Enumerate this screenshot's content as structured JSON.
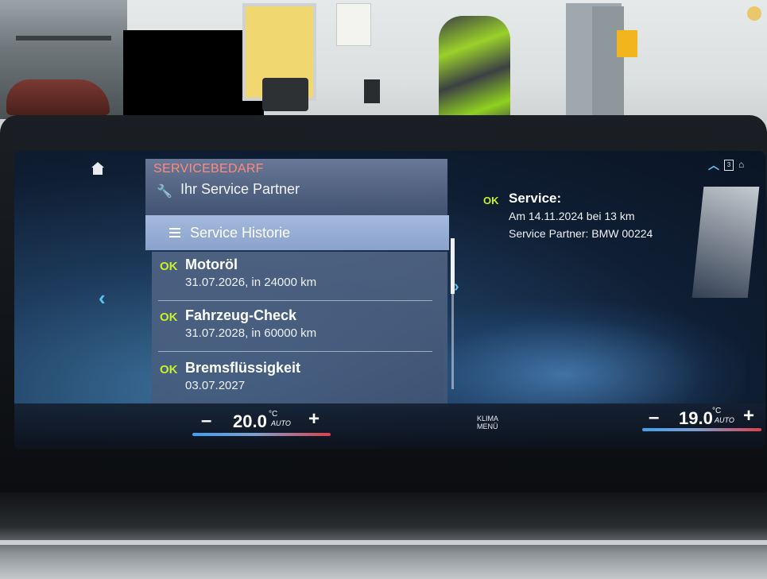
{
  "menu": {
    "title": "SERVICEBEDARF",
    "partner_label": "Ihr Service Partner",
    "selected_label": "Service Historie",
    "items": [
      {
        "status": "OK",
        "name": "Motoröl",
        "detail": "31.07.2026, in 24000 km"
      },
      {
        "status": "OK",
        "name": "Fahrzeug-Check",
        "detail": "31.07.2028, in 60000 km"
      },
      {
        "status": "OK",
        "name": "Bremsflüssigkeit",
        "detail": "03.07.2027"
      }
    ]
  },
  "info": {
    "status": "OK",
    "title": "Service:",
    "line1": "Am 14.11.2024 bei 13 km",
    "line2": "Service Partner: BMW 00224"
  },
  "nav": {
    "left": "‹",
    "right": "›"
  },
  "climate": {
    "left": {
      "minus": "–",
      "temp": "20.0",
      "unit": "°C",
      "mode": "AUTO",
      "plus": "+"
    },
    "right": {
      "minus": "–",
      "temp": "19.0",
      "unit": "°C",
      "mode": "AUTO",
      "plus": "+"
    },
    "menu_line1": "KLIMA",
    "menu_line2": "MENÜ"
  },
  "status_bar": {
    "battery": "3"
  },
  "colors": {
    "ok": "#c7ef2b",
    "title": "#ff8b7d",
    "accent": "#5fc2f2"
  }
}
